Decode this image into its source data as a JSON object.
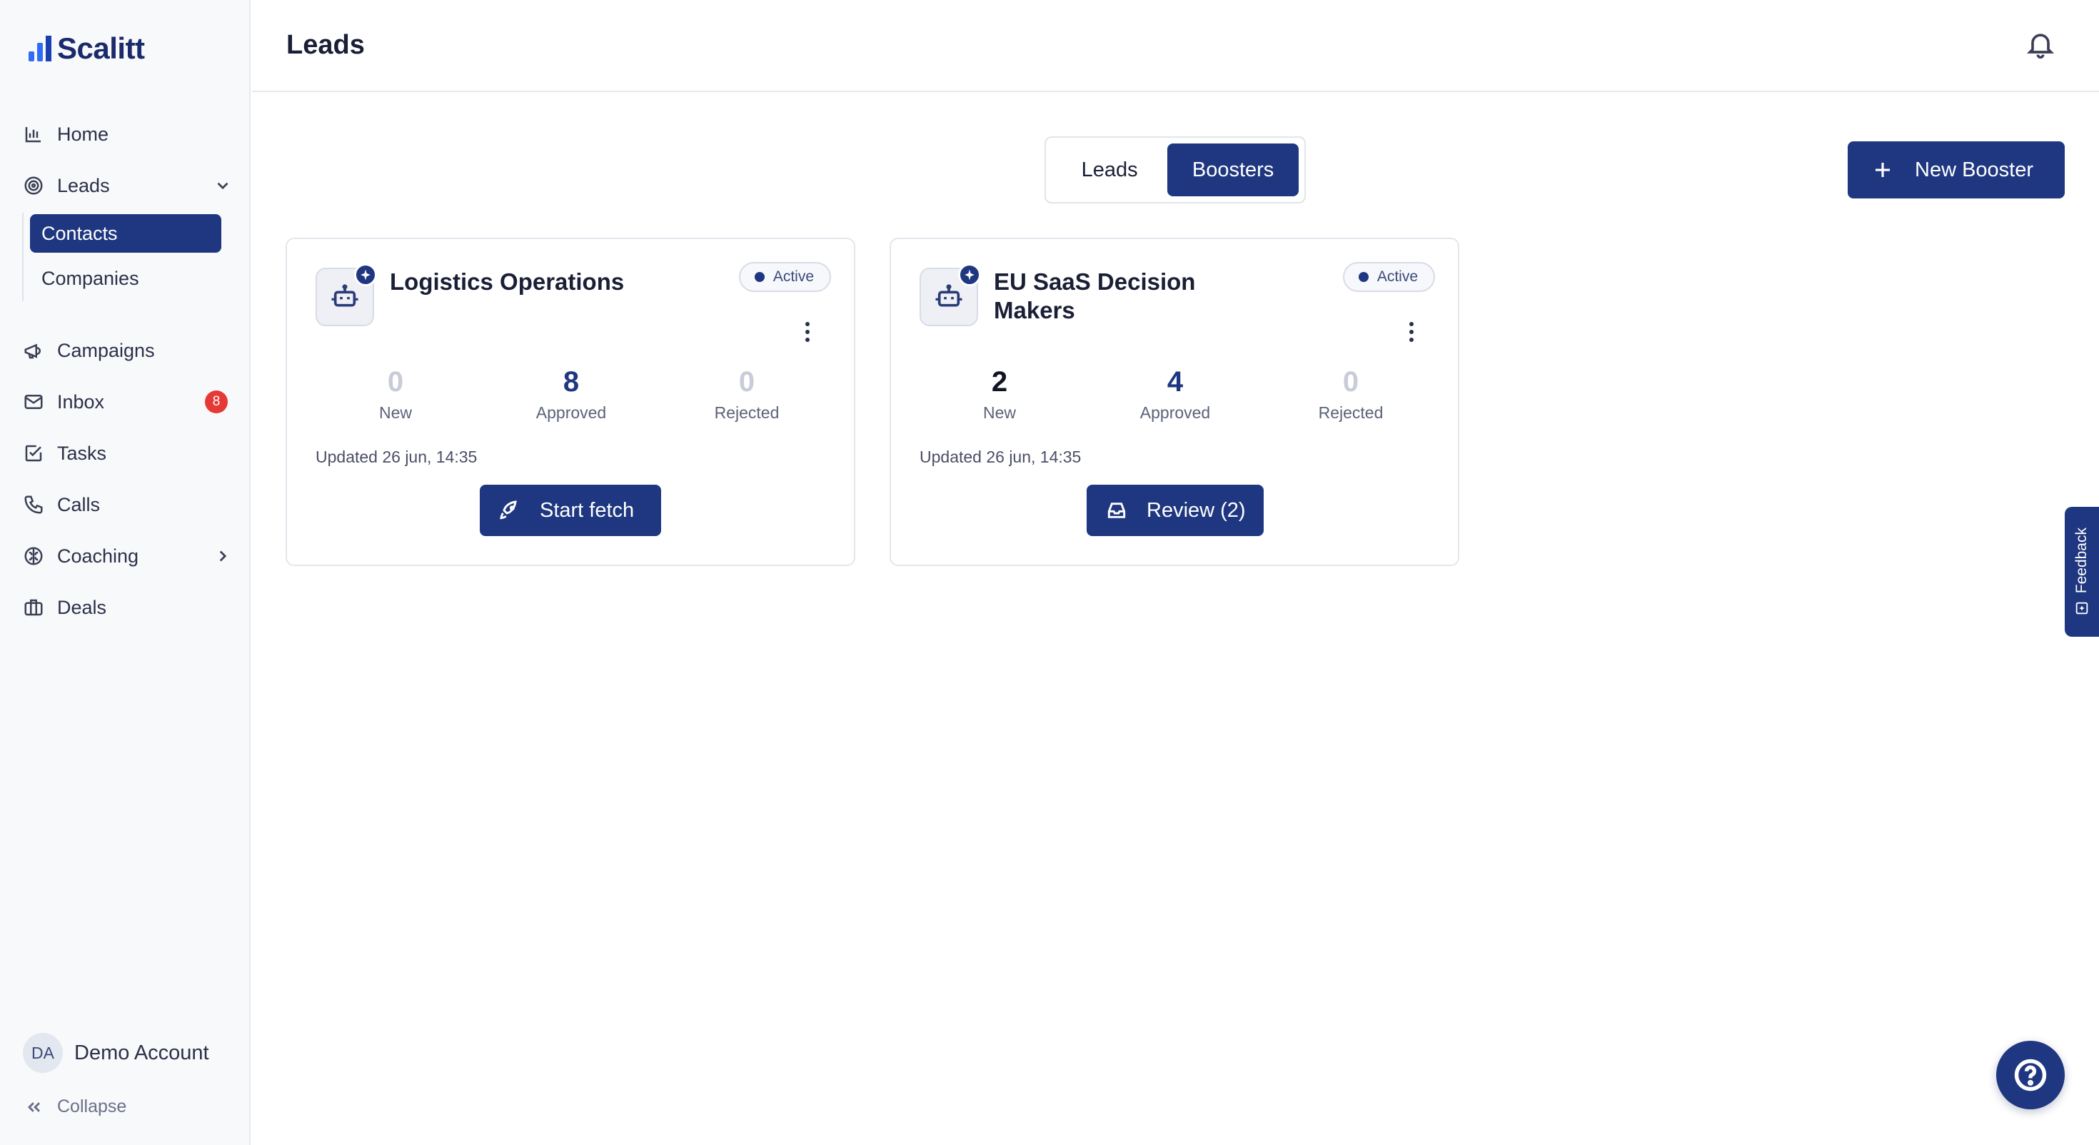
{
  "brand": {
    "name": "Scalitt",
    "accent": "#1f3780"
  },
  "sidebar": {
    "items": [
      {
        "label": "Home",
        "icon": "chart-bar-icon"
      },
      {
        "label": "Leads",
        "icon": "target-icon"
      },
      {
        "label": "Campaigns",
        "icon": "megaphone-icon"
      },
      {
        "label": "Inbox",
        "icon": "mail-icon",
        "badge": "8"
      },
      {
        "label": "Tasks",
        "icon": "checkbox-icon"
      },
      {
        "label": "Calls",
        "icon": "phone-icon"
      },
      {
        "label": "Coaching",
        "icon": "brain-icon"
      },
      {
        "label": "Deals",
        "icon": "briefcase-icon"
      }
    ],
    "sub_items": [
      {
        "label": "Contacts",
        "active": true
      },
      {
        "label": "Companies",
        "active": false
      }
    ],
    "account": {
      "initials": "DA",
      "name": "Demo Account"
    },
    "collapse_label": "Collapse"
  },
  "header": {
    "title": "Leads"
  },
  "toggle": {
    "leads": "Leads",
    "boosters": "Boosters",
    "selected": "Boosters"
  },
  "new_booster_label": "New Booster",
  "cards": [
    {
      "title": "Logistics Operations",
      "status": "Active",
      "stats": [
        {
          "value": "0",
          "label": "New"
        },
        {
          "value": "8",
          "label": "Approved"
        },
        {
          "value": "0",
          "label": "Rejected"
        }
      ],
      "updated": "Updated 26 jun, 14:35",
      "action": "Start fetch"
    },
    {
      "title": "EU SaaS Decision Makers",
      "status": "Active",
      "stats": [
        {
          "value": "2",
          "label": "New"
        },
        {
          "value": "4",
          "label": "Approved"
        },
        {
          "value": "0",
          "label": "Rejected"
        }
      ],
      "updated": "Updated 26 jun, 14:35",
      "action": "Review (2)"
    }
  ],
  "feedback_label": "Feedback"
}
